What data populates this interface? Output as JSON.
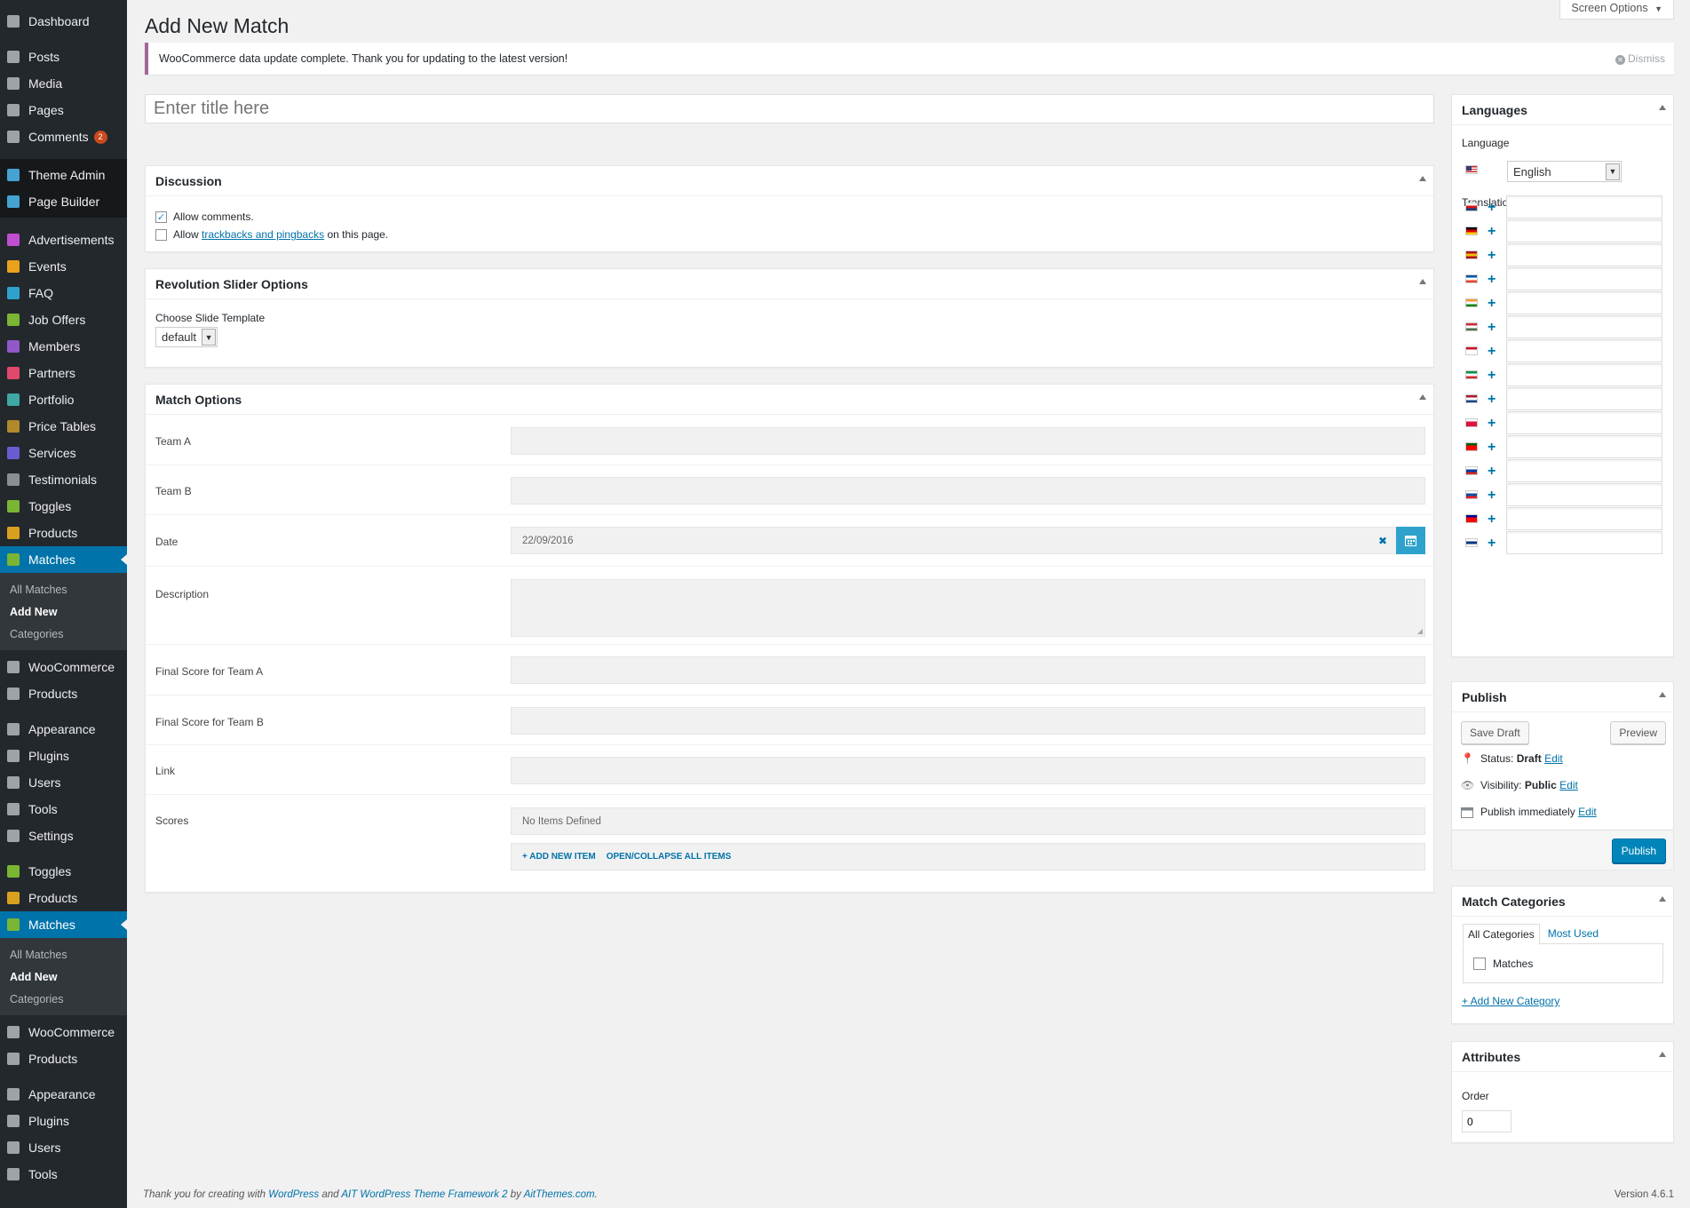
{
  "sidebar": {
    "group1": [
      {
        "label": "Dashboard",
        "icon": "dashboard-icon",
        "color": "#9ea3a8"
      },
      {
        "sep": true
      },
      {
        "label": "Posts",
        "icon": "pin-icon",
        "color": "#9ea3a8"
      },
      {
        "label": "Media",
        "icon": "media-icon",
        "color": "#9ea3a8"
      },
      {
        "label": "Pages",
        "icon": "pages-icon",
        "color": "#9ea3a8"
      },
      {
        "label": "Comments",
        "icon": "comment-icon",
        "color": "#9ea3a8",
        "badge": "2"
      }
    ],
    "group_dark": [
      {
        "label": "Theme Admin",
        "icon": "theme-admin-icon",
        "color": "#45a3d1"
      },
      {
        "label": "Page Builder",
        "icon": "page-builder-icon",
        "color": "#45a3d1"
      }
    ],
    "group2": [
      {
        "label": "Advertisements",
        "icon": "advertisements-icon",
        "color": "#c04ed0"
      },
      {
        "label": "Events",
        "icon": "events-icon",
        "color": "#e9a21b"
      },
      {
        "label": "FAQ",
        "icon": "faq-icon",
        "color": "#2ea2cc"
      },
      {
        "label": "Job Offers",
        "icon": "job-offers-icon",
        "color": "#7ab534"
      },
      {
        "label": "Members",
        "icon": "members-icon",
        "color": "#9058c8"
      },
      {
        "label": "Partners",
        "icon": "partners-icon",
        "color": "#e2486b"
      },
      {
        "label": "Portfolio",
        "icon": "portfolio-icon",
        "color": "#3fa7a4"
      },
      {
        "label": "Price Tables",
        "icon": "price-tables-icon",
        "color": "#b0892c"
      },
      {
        "label": "Services",
        "icon": "services-icon",
        "color": "#6b5bd2"
      },
      {
        "label": "Testimonials",
        "icon": "testimonials-icon",
        "color": "#8a8f94"
      },
      {
        "label": "Toggles",
        "icon": "toggles-icon",
        "color": "#7ab534"
      },
      {
        "label": "Products",
        "icon": "products-icon",
        "color": "#d9a020"
      },
      {
        "label": "Matches",
        "icon": "matches-icon",
        "color": "#7ab534",
        "current": true
      }
    ],
    "submenu1": [
      {
        "label": "All Matches"
      },
      {
        "label": "Add New",
        "active": true
      },
      {
        "label": "Categories"
      }
    ],
    "group3": [
      {
        "label": "WooCommerce",
        "icon": "woocommerce-icon",
        "color": "#9ea3a8"
      },
      {
        "label": "Products",
        "icon": "box-icon",
        "color": "#9ea3a8"
      },
      {
        "sep": true
      },
      {
        "label": "Appearance",
        "icon": "brush-icon",
        "color": "#9ea3a8"
      },
      {
        "label": "Plugins",
        "icon": "plug-icon",
        "color": "#9ea3a8"
      },
      {
        "label": "Users",
        "icon": "user-icon",
        "color": "#9ea3a8"
      },
      {
        "label": "Tools",
        "icon": "wrench-icon",
        "color": "#9ea3a8"
      },
      {
        "label": "Settings",
        "icon": "settings-icon",
        "color": "#9ea3a8"
      },
      {
        "sep": true
      },
      {
        "label": "Toggles",
        "icon": "toggles-icon",
        "color": "#7ab534"
      },
      {
        "label": "Products",
        "icon": "products-icon",
        "color": "#d9a020"
      },
      {
        "label": "Matches",
        "icon": "matches-icon",
        "color": "#7ab534",
        "current": true
      }
    ],
    "submenu2": [
      {
        "label": "All Matches"
      },
      {
        "label": "Add New",
        "active": true
      },
      {
        "label": "Categories"
      }
    ],
    "group4": [
      {
        "label": "WooCommerce",
        "icon": "woocommerce-icon",
        "color": "#9ea3a8"
      },
      {
        "label": "Products",
        "icon": "box-icon",
        "color": "#9ea3a8"
      },
      {
        "sep": true
      },
      {
        "label": "Appearance",
        "icon": "brush-icon",
        "color": "#9ea3a8"
      },
      {
        "label": "Plugins",
        "icon": "plug-icon",
        "color": "#9ea3a8"
      },
      {
        "label": "Users",
        "icon": "user-icon",
        "color": "#9ea3a8"
      },
      {
        "label": "Tools",
        "icon": "wrench-icon",
        "color": "#9ea3a8"
      }
    ]
  },
  "header": {
    "title": "Add New Match",
    "screen_options": "Screen Options"
  },
  "notice": {
    "text": "WooCommerce data update complete. Thank you for updating to the latest version!",
    "dismiss": "Dismiss"
  },
  "title_input": {
    "placeholder": "Enter title here"
  },
  "discussion": {
    "heading": "Discussion",
    "allow_comments": "Allow comments.",
    "allow_prefix": "Allow",
    "trackbacks_link": "trackbacks and pingbacks",
    "allow_suffix": "on this page."
  },
  "revslider": {
    "heading": "Revolution Slider Options",
    "label": "Choose Slide Template",
    "value": "default"
  },
  "match_options": {
    "heading": "Match Options",
    "team_a": "Team A",
    "team_b": "Team B",
    "date": "Date",
    "date_value": "22/09/2016",
    "description": "Description",
    "final_a": "Final Score for Team A",
    "final_b": "Final Score for Team B",
    "link": "Link",
    "scores": "Scores",
    "no_items": "No Items Defined",
    "add_new_item": "+ ADD NEW ITEM",
    "open_collapse": "OPEN/COLLAPSE ALL ITEMS"
  },
  "languages": {
    "heading": "Languages",
    "language_label": "Language",
    "language_value": "English",
    "translations_label": "Translations",
    "flags": [
      {
        "name": "czech-flag",
        "colors": [
          "#ffffff",
          "#d7141a",
          "#11457e"
        ]
      },
      {
        "name": "german-flag",
        "colors": [
          "#000000",
          "#dd0000",
          "#ffce00"
        ]
      },
      {
        "name": "spanish-flag",
        "colors": [
          "#aa151b",
          "#f1bf00",
          "#aa151b"
        ]
      },
      {
        "name": "french-flag",
        "colors": [
          "#0055a4",
          "#ffffff",
          "#ef4135"
        ]
      },
      {
        "name": "indian-flag",
        "colors": [
          "#ff9933",
          "#ffffff",
          "#138808"
        ]
      },
      {
        "name": "hungarian-flag",
        "colors": [
          "#ce2939",
          "#ffffff",
          "#477050"
        ]
      },
      {
        "name": "indonesian-flag",
        "colors": [
          "#ce1126",
          "#ffffff",
          "#ffffff"
        ]
      },
      {
        "name": "italian-flag",
        "colors": [
          "#009246",
          "#ffffff",
          "#ce2b37"
        ]
      },
      {
        "name": "dutch-flag",
        "colors": [
          "#ae1c28",
          "#ffffff",
          "#21468b"
        ]
      },
      {
        "name": "polish-flag",
        "colors": [
          "#ffffff",
          "#dc143c",
          "#dc143c"
        ]
      },
      {
        "name": "portuguese-flag",
        "colors": [
          "#006600",
          "#ff0000",
          "#ff0000"
        ]
      },
      {
        "name": "russian-flag",
        "colors": [
          "#ffffff",
          "#0039a6",
          "#d52b1e"
        ]
      },
      {
        "name": "slovak-flag",
        "colors": [
          "#ffffff",
          "#0b4ea2",
          "#ee1c25"
        ]
      },
      {
        "name": "taiwanese-flag",
        "colors": [
          "#000095",
          "#fe0000",
          "#fe0000"
        ]
      },
      {
        "name": "finnish-flag",
        "colors": [
          "#ffffff",
          "#003580",
          "#ffffff"
        ]
      }
    ]
  },
  "publish": {
    "heading": "Publish",
    "save_draft": "Save Draft",
    "preview": "Preview",
    "status_label": "Status:",
    "status_value": "Draft",
    "visibility_label": "Visibility:",
    "visibility_value": "Public",
    "publish_immediately": "Publish immediately",
    "edit": "Edit",
    "publish_button": "Publish"
  },
  "categories": {
    "heading": "Match Categories",
    "tab_all": "All Categories",
    "tab_most_used": "Most Used",
    "item": "Matches",
    "add_new": "+ Add New Category"
  },
  "attributes": {
    "heading": "Attributes",
    "order_label": "Order",
    "order_value": "0"
  },
  "footer": {
    "prefix": "Thank you for creating with",
    "wp_link": "WordPress",
    "and": "and",
    "ait_link": "AIT WordPress Theme Framework 2",
    "by": "by",
    "aitthemes_link": "AitThemes.com",
    "period": ".",
    "version": "Version 4.6.1"
  }
}
